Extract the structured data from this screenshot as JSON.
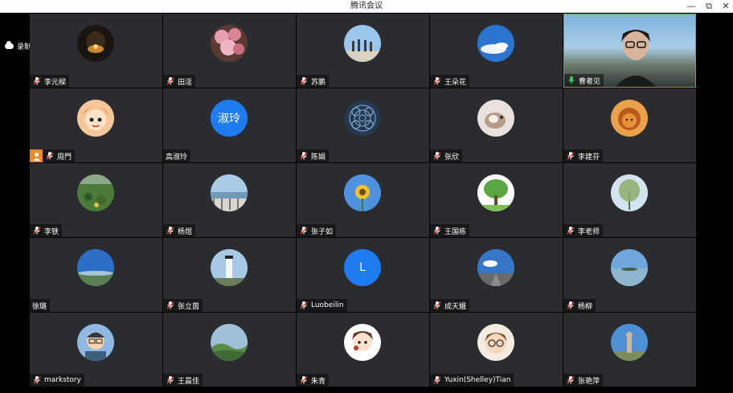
{
  "window": {
    "title": "腾讯会议",
    "controls": {
      "minimize": "—",
      "restore": "⧉",
      "close": "✕"
    }
  },
  "recording": {
    "label": "录制中",
    "icon": "cloud-icon"
  },
  "participants": [
    {
      "name": "李元樑",
      "avatar": "night-lamp"
    },
    {
      "name": "田淫",
      "avatar": "pink-flowers"
    },
    {
      "name": "苏鹏",
      "avatar": "people-sky"
    },
    {
      "name": "王朵花",
      "avatar": "blue-sky"
    },
    {
      "name": "曹者见",
      "avatar": "camera-video",
      "speaking": true
    },
    {
      "name": "周門",
      "avatar": "cartoon-girl",
      "host": true
    },
    {
      "name": "高淑玲",
      "avatar": "letter",
      "letter": "淑玲",
      "no_mic": true
    },
    {
      "name": "陈娟",
      "avatar": "pattern"
    },
    {
      "name": "张欣",
      "avatar": "kitten"
    },
    {
      "name": "李建芬",
      "avatar": "lion-king"
    },
    {
      "name": "李铁",
      "avatar": "green-field"
    },
    {
      "name": "杨煜",
      "avatar": "lake-rail"
    },
    {
      "name": "张子如",
      "avatar": "sunflower"
    },
    {
      "name": "王国栋",
      "avatar": "tree"
    },
    {
      "name": "李老师",
      "avatar": "willow"
    },
    {
      "name": "徐璐",
      "avatar": "blue-horizon",
      "no_mic": true
    },
    {
      "name": "张立茵",
      "avatar": "lighthouse"
    },
    {
      "name": "Luobeilin",
      "avatar": "letter",
      "letter": "L"
    },
    {
      "name": "成天娥",
      "avatar": "road-sky"
    },
    {
      "name": "杨柳",
      "avatar": "sea-sky"
    },
    {
      "name": "markstory",
      "avatar": "cartoon-man"
    },
    {
      "name": "王晨佳",
      "avatar": "hills"
    },
    {
      "name": "朱青",
      "avatar": "cartoon-kid"
    },
    {
      "name": "Yuxin(Shelley)Tian",
      "avatar": "glasses-girl"
    },
    {
      "name": "张艳萍",
      "avatar": "statue"
    }
  ]
}
